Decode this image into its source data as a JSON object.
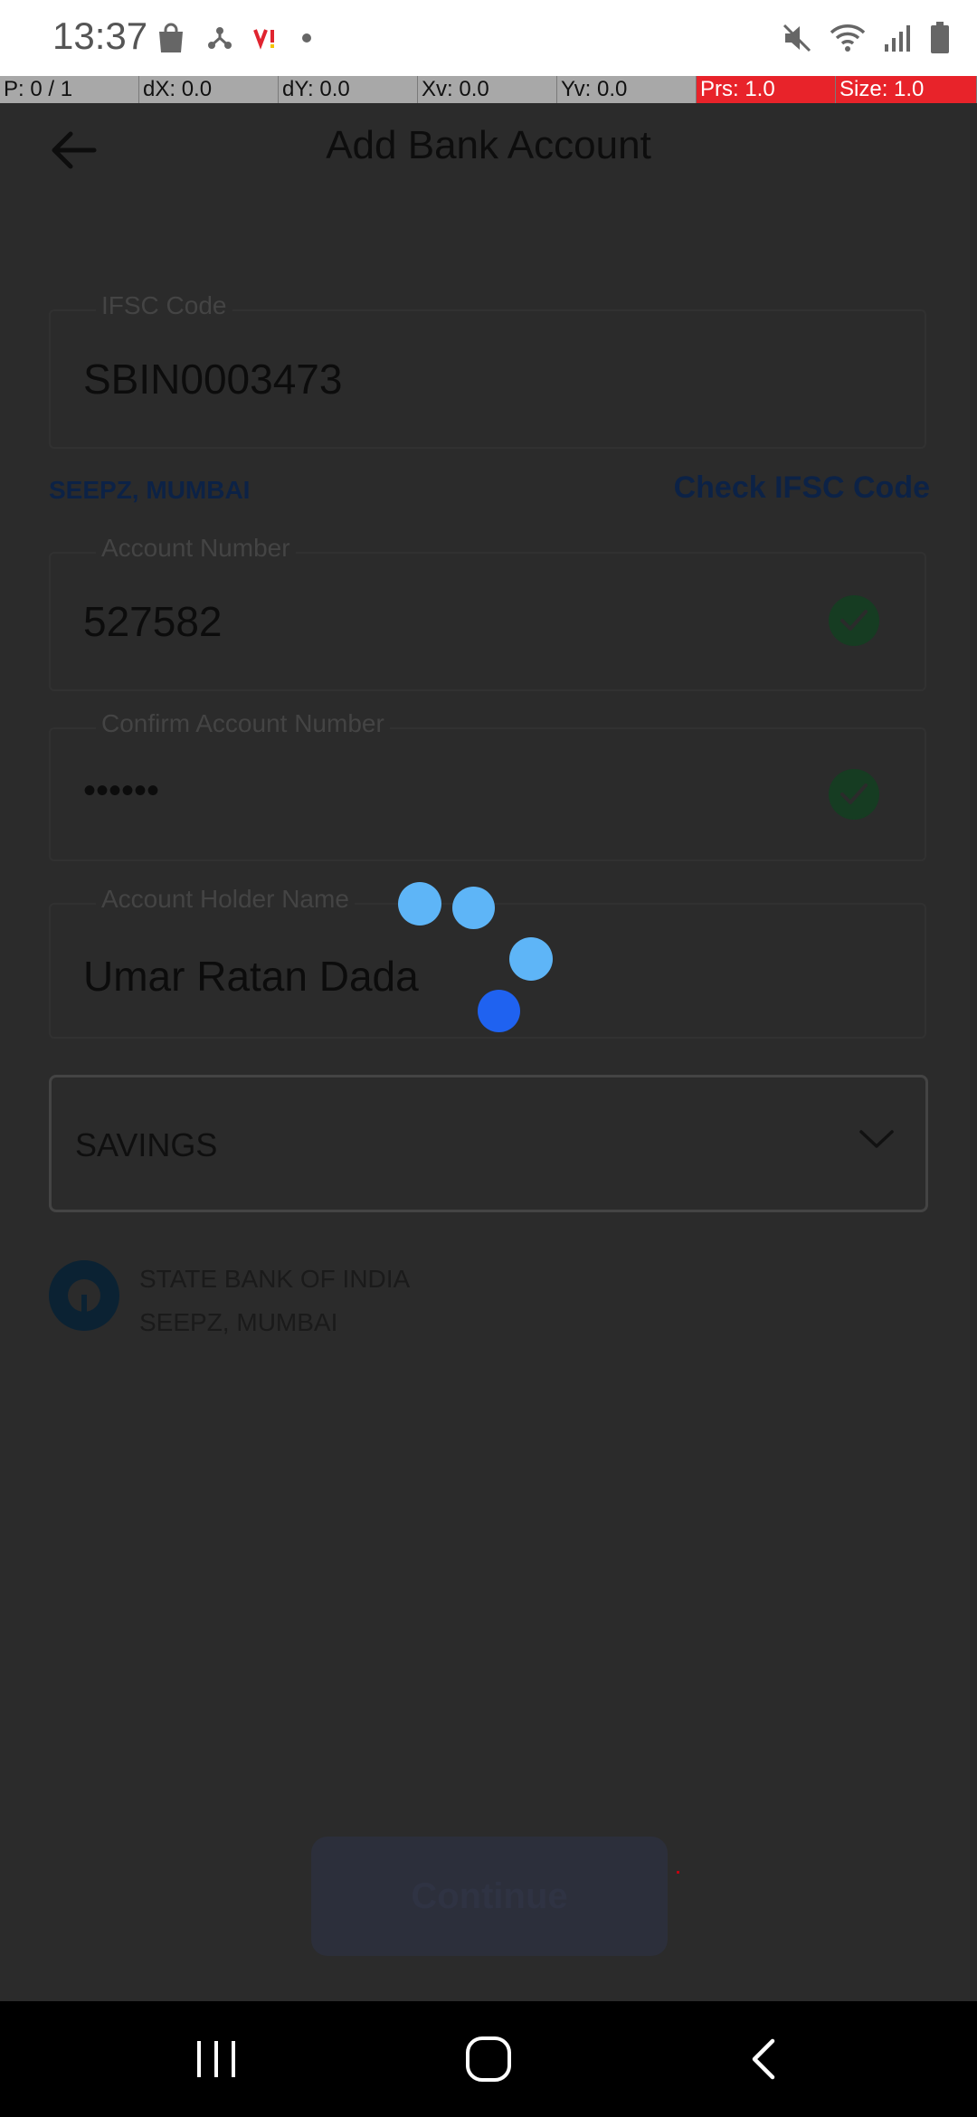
{
  "status_bar": {
    "time": "13:37",
    "left_icons": [
      "shopping-bag-icon",
      "share-hub-icon",
      "vi-logo-icon",
      "dot-icon"
    ],
    "right_icons": [
      "mute-icon",
      "wifi-icon",
      "signal-icon",
      "battery-icon"
    ]
  },
  "pointer_bar": {
    "p": "P: 0 / 1",
    "dx": "dX: 0.0",
    "dy": "dY: 0.0",
    "xv": "Xv: 0.0",
    "yv": "Yv: 0.0",
    "prs": "Prs: 1.0",
    "size": "Size: 1.0"
  },
  "header": {
    "title": "Add Bank Account"
  },
  "form": {
    "ifsc": {
      "label": "IFSC Code",
      "value": "SBIN0003473"
    },
    "branch_hint": "SEEPZ, MUMBAI",
    "check_ifsc_link": "Check IFSC Code",
    "account_number": {
      "label": "Account Number",
      "value": "527582"
    },
    "confirm_account_number": {
      "label": "Confirm Account Number",
      "value": "••••••"
    },
    "account_holder": {
      "label": "Account Holder Name",
      "value": "Umar Ratan Dada"
    },
    "account_type": {
      "selected": "SAVINGS"
    }
  },
  "bank_info": {
    "name": "STATE BANK OF INDIA",
    "branch": "SEEPZ, MUMBAI"
  },
  "actions": {
    "continue_label": "Continue"
  },
  "colors": {
    "overlay_bg": "#2b2b2b",
    "spinner_light": "#5eb5f7",
    "spinner_dark": "#1f62f0",
    "pointer_bar_red": "#e8232a"
  }
}
